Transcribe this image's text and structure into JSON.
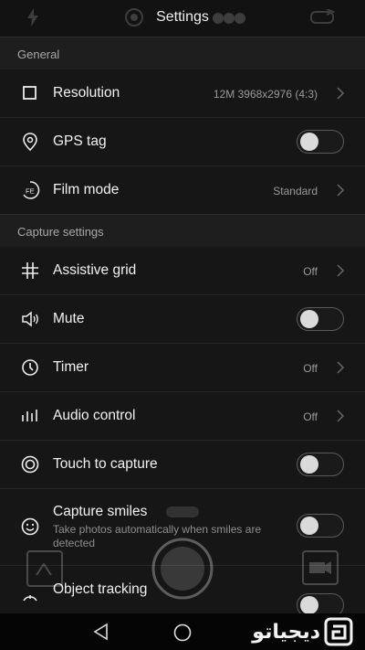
{
  "header": {
    "title": "Settings"
  },
  "sections": {
    "general": "General",
    "capture": "Capture settings"
  },
  "rows": {
    "resolution": {
      "label": "Resolution",
      "value": "12M 3968x2976 (4:3)"
    },
    "gps": {
      "label": "GPS tag",
      "toggle_on": false
    },
    "film": {
      "label": "Film mode",
      "value": "Standard"
    },
    "grid": {
      "label": "Assistive grid",
      "value": "Off"
    },
    "mute": {
      "label": "Mute",
      "toggle_on": false
    },
    "timer": {
      "label": "Timer",
      "value": "Off"
    },
    "audio": {
      "label": "Audio control",
      "value": "Off"
    },
    "touch": {
      "label": "Touch to capture",
      "toggle_on": false
    },
    "smiles": {
      "label": "Capture smiles",
      "sublabel": "Take photos automatically when smiles are detected",
      "toggle_on": false
    },
    "tracking": {
      "label": "Object tracking",
      "toggle_on": false
    }
  },
  "icons": {
    "resolution": "square-icon",
    "gps": "location-pin-icon",
    "film": "film-mode-icon",
    "grid": "grid-icon",
    "mute": "speaker-icon",
    "timer": "clock-icon",
    "audio": "audio-bars-icon",
    "touch": "target-icon",
    "smiles": "smile-icon",
    "tracking": "tracking-icon"
  },
  "watermark": {
    "text": "دیجیاتو"
  },
  "colors": {
    "background": "#0b0b0b",
    "row": "#161616",
    "section": "#1e1e1e",
    "text": "#f2f2f2",
    "muted": "#9a9a9a"
  }
}
